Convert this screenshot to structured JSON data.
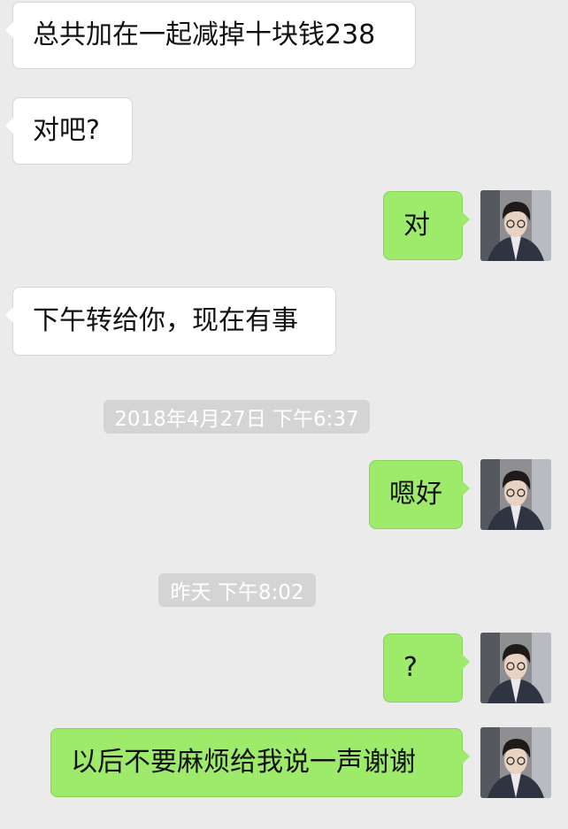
{
  "chat": {
    "messages": [
      {
        "side": "left",
        "text": "总共加在一起减掉十块钱238"
      },
      {
        "side": "left",
        "text": "对吧?"
      },
      {
        "side": "right",
        "text": "对"
      },
      {
        "side": "left",
        "text": "下午转给你，现在有事"
      },
      {
        "side": "right",
        "text": "嗯好"
      },
      {
        "side": "right",
        "text": "?"
      },
      {
        "side": "right",
        "text": "以后不要麻烦给我说一声谢谢"
      }
    ],
    "timestamps": [
      {
        "text": "2018年4月27日 下午6:37"
      },
      {
        "text": "昨天 下午8:02"
      }
    ]
  },
  "colors": {
    "background": "#ebebeb",
    "bubble_left": "#ffffff",
    "bubble_right": "#9eea6a",
    "timestamp_bg": "#d4d4d4"
  },
  "icons": {
    "avatar": "user-avatar-icon"
  }
}
